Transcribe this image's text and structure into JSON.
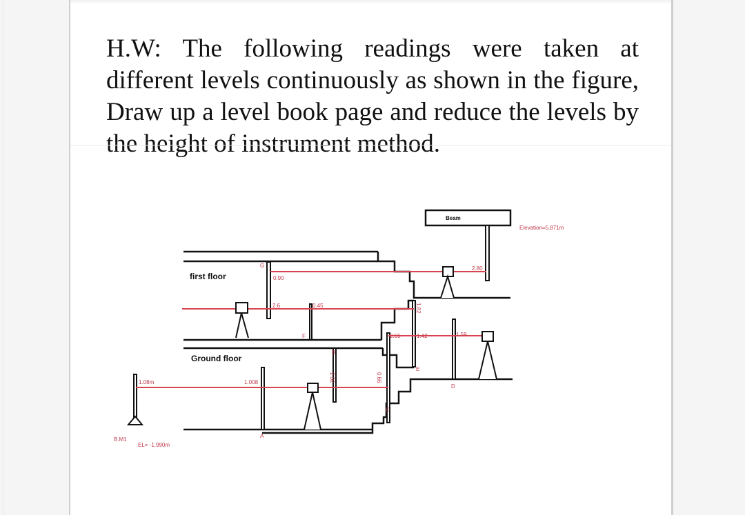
{
  "viewer": {
    "background": "#f5f5f5",
    "page_background": "#ffffff"
  },
  "question": {
    "text": "H.W: The following readings were taken at different levels continuously as shown in the figure, Draw up a level book page and reduce the levels by the height of instrument method."
  },
  "figure": {
    "colors": {
      "sight_line": "#d9434f",
      "structure": "#111111",
      "label": "#c0394a"
    },
    "floors": {
      "first_floor": "first floor",
      "ground_floor": "Ground floor",
      "beam": "Beam"
    },
    "benchmark": {
      "name": "B.M1",
      "elevation": "EL= -1.990m"
    },
    "beam_elevation": "Elevation=5.871m",
    "stations": {
      "A": "A",
      "B": "B",
      "C": "C",
      "D": "D",
      "E": "E",
      "F": "F",
      "G": "G"
    },
    "readings": {
      "bm1": "1.08m",
      "A": "1.008",
      "B": "2.32",
      "C": "0.66",
      "E_back": "2.55",
      "E_fore": "1.42",
      "D": "1.59",
      "upper_stair": "1.82",
      "F": "0.45",
      "G_lower": "2.6",
      "G_upper": "0.90",
      "beam": "2.80"
    }
  }
}
